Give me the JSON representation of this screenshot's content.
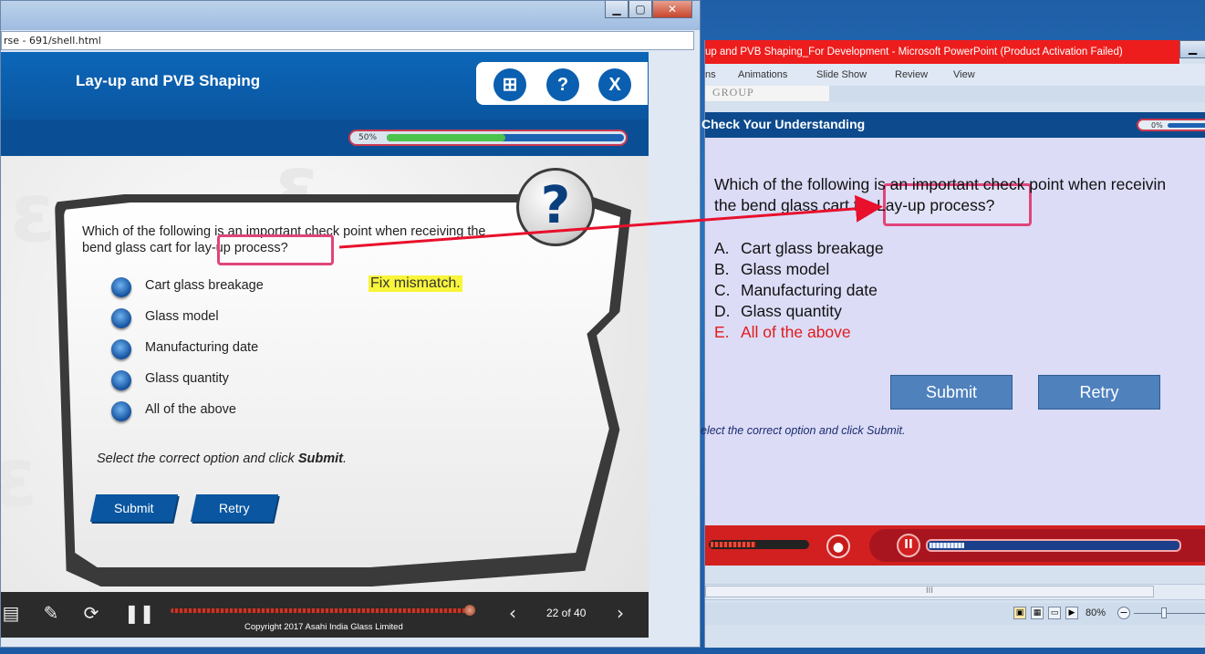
{
  "browser": {
    "address": "rse - 691/shell.html",
    "controls": {
      "minimize": "▁",
      "maximize": "▢",
      "close": "✕"
    }
  },
  "course": {
    "title": "Lay-up and PVB Shaping",
    "header_buttons": {
      "sitemap": "⊞",
      "help": "?",
      "exit": "X"
    },
    "progress_label": "50%",
    "progress_value": 0.5,
    "question_icon": "?",
    "question": "Which of the following is an important check point when receiving the bend glass cart for lay-up process?",
    "options": [
      "Cart glass breakage",
      "Glass model",
      "Manufacturing date",
      "Glass quantity",
      "All of the above"
    ],
    "annotation_note": "Fix mismatch.",
    "instruction_prefix": "Select the correct option and click ",
    "instruction_bold": "Submit",
    "instruction_suffix": ".",
    "submit_label": "Submit",
    "retry_label": "Retry",
    "page_counter": "22 of 40",
    "copyright": "Copyright 2017 Asahi India Glass Limited",
    "seek_value": 0.98
  },
  "ppt": {
    "title": "up and PVB Shaping_For Development  -  Microsoft PowerPoint (Product Activation Failed)",
    "tabs": [
      "ns",
      "Animations",
      "Slide Show",
      "Review",
      "View"
    ],
    "group_label": "GROUP",
    "slide_title": "Check Your Understanding",
    "progress_label": "0%",
    "question_line1": "Which of the following is an important check point when receivin",
    "question_line2": "the bend glass cart for Lay-up process?",
    "options": [
      {
        "letter": "A.",
        "text": "Cart glass breakage"
      },
      {
        "letter": "B.",
        "text": "Glass model"
      },
      {
        "letter": "C.",
        "text": "Manufacturing  date"
      },
      {
        "letter": "D.",
        "text": "Glass quantity"
      },
      {
        "letter": "E.",
        "text": "All of the above"
      }
    ],
    "correct_color": "#e21b1b",
    "submit_label": "Submit",
    "retry_label": "Retry",
    "instruction": "elect the correct option and click Submit.",
    "zoom": "80%",
    "scroll_grip": "III"
  },
  "colors": {
    "accent": "#0a56a0",
    "highlight": "#e0457a",
    "arrow": "#e8102c",
    "note_bg": "#f8f53b"
  }
}
